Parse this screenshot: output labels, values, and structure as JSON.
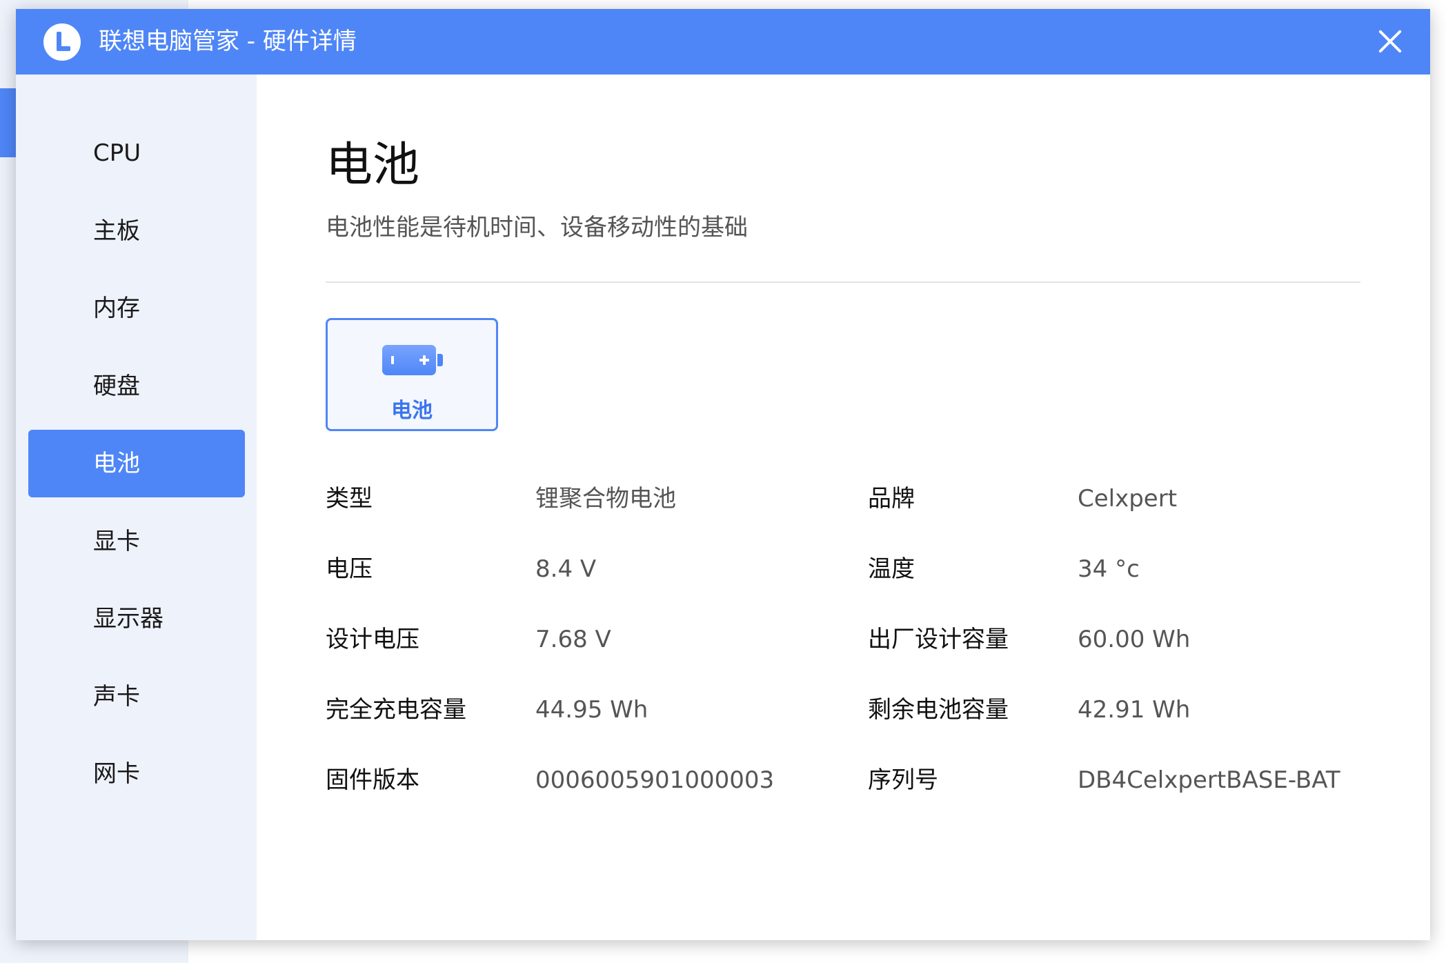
{
  "window": {
    "title": "联想电脑管家 - 硬件详情"
  },
  "sidebar": {
    "items": [
      {
        "label": "CPU",
        "active": false
      },
      {
        "label": "主板",
        "active": false
      },
      {
        "label": "内存",
        "active": false
      },
      {
        "label": "硬盘",
        "active": false
      },
      {
        "label": "电池",
        "active": true
      },
      {
        "label": "显卡",
        "active": false
      },
      {
        "label": "显示器",
        "active": false
      },
      {
        "label": "声卡",
        "active": false
      },
      {
        "label": "网卡",
        "active": false
      }
    ]
  },
  "main": {
    "title": "电池",
    "subtitle": "电池性能是待机时间、设备移动性的基础",
    "device_card": {
      "label": "电池",
      "icon": "battery-icon"
    },
    "specs": [
      {
        "key": "类型",
        "value": "锂聚合物电池"
      },
      {
        "key": "品牌",
        "value": "Celxpert"
      },
      {
        "key": "电压",
        "value": "8.4 V"
      },
      {
        "key": "温度",
        "value": "34 °c"
      },
      {
        "key": "设计电压",
        "value": "7.68 V"
      },
      {
        "key": "出厂设计容量",
        "value": "60.00 Wh"
      },
      {
        "key": "完全充电容量",
        "value": "44.95 Wh"
      },
      {
        "key": "剩余电池容量",
        "value": "42.91 Wh"
      },
      {
        "key": "固件版本",
        "value": "0006005901000003"
      },
      {
        "key": "序列号",
        "value": "DB4CelxpertBASE-BAT"
      }
    ]
  },
  "colors": {
    "accent": "#4f86f7",
    "sidebar_bg": "#eef2fb",
    "label_text": "#111111",
    "value_text": "#555555"
  }
}
